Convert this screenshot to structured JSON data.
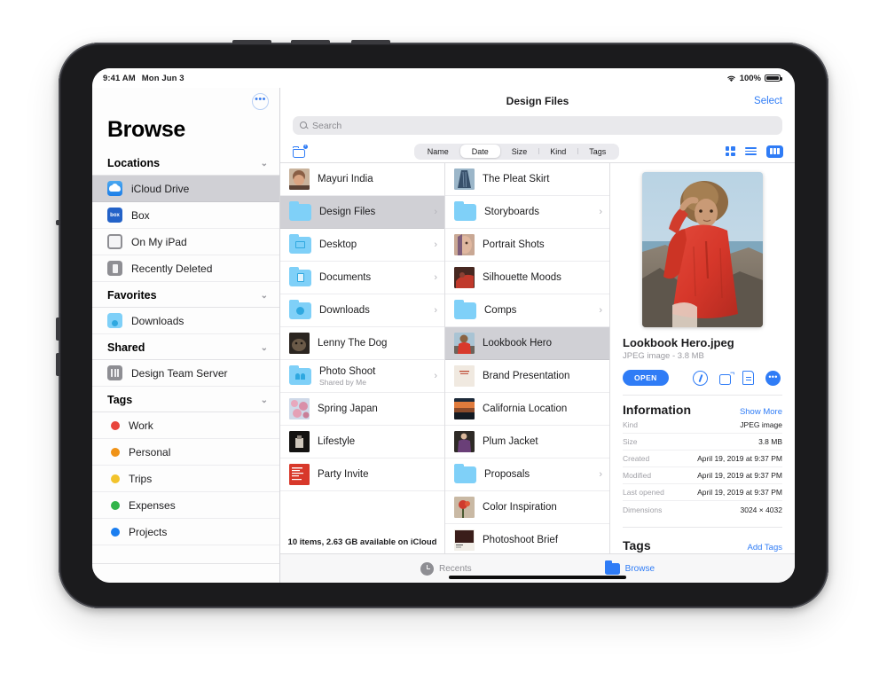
{
  "status_bar": {
    "time": "9:41 AM",
    "date": "Mon Jun 3",
    "battery_percent": "100%",
    "wifi_icon": "wifi-icon",
    "battery_icon": "battery-full-icon"
  },
  "sidebar": {
    "more_button": "•••",
    "title": "Browse",
    "sections": [
      {
        "name": "Locations",
        "chevron": "⌄",
        "items": [
          {
            "label": "iCloud Drive",
            "icon": "icloud-icon",
            "selected": true
          },
          {
            "label": "Box",
            "icon": "box-icon",
            "selected": false
          },
          {
            "label": "On My iPad",
            "icon": "ipad-icon",
            "selected": false
          },
          {
            "label": "Recently Deleted",
            "icon": "trash-icon",
            "selected": false
          }
        ]
      },
      {
        "name": "Favorites",
        "chevron": "⌄",
        "items": [
          {
            "label": "Downloads",
            "icon": "downloads-folder-icon",
            "selected": false
          }
        ]
      },
      {
        "name": "Shared",
        "chevron": "⌄",
        "items": [
          {
            "label": "Design Team Server",
            "icon": "server-icon",
            "selected": false
          }
        ]
      },
      {
        "name": "Tags",
        "chevron": "⌄",
        "items": [
          {
            "label": "Work",
            "icon": "tag-dot-icon",
            "color": "#e8453c",
            "selected": false
          },
          {
            "label": "Personal",
            "icon": "tag-dot-icon",
            "color": "#f09318",
            "selected": false
          },
          {
            "label": "Trips",
            "icon": "tag-dot-icon",
            "color": "#f2c32c",
            "selected": false
          },
          {
            "label": "Expenses",
            "icon": "tag-dot-icon",
            "color": "#32b44a",
            "selected": false
          },
          {
            "label": "Projects",
            "icon": "tag-dot-icon",
            "color": "#1b7ef0",
            "selected": false
          }
        ]
      }
    ]
  },
  "nav": {
    "title": "Design Files",
    "select_label": "Select"
  },
  "search": {
    "placeholder": "Search",
    "value": "",
    "icon": "search-icon"
  },
  "toolbar": {
    "new_folder_icon": "new-folder-icon",
    "sort_options": [
      "Name",
      "Date",
      "Size",
      "Kind",
      "Tags"
    ],
    "sort_selected": "Date",
    "view_modes": [
      {
        "icon": "grid-view-icon",
        "active": false
      },
      {
        "icon": "list-view-icon",
        "active": false
      },
      {
        "icon": "column-view-icon",
        "active": true
      }
    ]
  },
  "column_one": {
    "items": [
      {
        "label": "Mayuri India",
        "type": "image",
        "thumb": "portrait-smiling",
        "chevron": false
      },
      {
        "label": "Design Files",
        "type": "folder",
        "folder_glyph": "plain",
        "chevron": true,
        "selected": true
      },
      {
        "label": "Desktop",
        "type": "folder",
        "folder_glyph": "desktop",
        "chevron": true
      },
      {
        "label": "Documents",
        "type": "folder",
        "folder_glyph": "doc",
        "chevron": true
      },
      {
        "label": "Downloads",
        "type": "folder",
        "folder_glyph": "download",
        "chevron": true
      },
      {
        "label": "Lenny The Dog",
        "type": "image",
        "thumb": "dog-dark",
        "chevron": false
      },
      {
        "label": "Photo Shoot",
        "sublabel": "Shared by Me",
        "type": "folder",
        "folder_glyph": "people",
        "chevron": true
      },
      {
        "label": "Spring Japan",
        "type": "image",
        "thumb": "blossom-pink",
        "chevron": false
      },
      {
        "label": "Lifestyle",
        "type": "image",
        "thumb": "dark-still",
        "chevron": false
      },
      {
        "label": "Party Invite",
        "type": "image",
        "thumb": "red-poster",
        "chevron": false
      }
    ],
    "footer": "10 items, 2.63 GB available on iCloud"
  },
  "column_two": {
    "items": [
      {
        "label": "The Pleat Skirt",
        "type": "image",
        "thumb": "pleat-skirt",
        "chevron": false
      },
      {
        "label": "Storyboards",
        "type": "folder",
        "folder_glyph": "plain",
        "chevron": true
      },
      {
        "label": "Portrait Shots",
        "type": "image",
        "thumb": "portrait-blur",
        "chevron": false
      },
      {
        "label": "Silhouette Moods",
        "type": "image",
        "thumb": "silhouette-red",
        "chevron": false
      },
      {
        "label": "Comps",
        "type": "folder",
        "folder_glyph": "plain",
        "chevron": true
      },
      {
        "label": "Lookbook Hero",
        "type": "image",
        "thumb": "lookbook-hero",
        "chevron": false,
        "selected": true
      },
      {
        "label": "Brand Presentation",
        "type": "image",
        "thumb": "brand-cream",
        "chevron": false
      },
      {
        "label": "California Location",
        "type": "image",
        "thumb": "california-sunset",
        "chevron": false
      },
      {
        "label": "Plum Jacket",
        "type": "image",
        "thumb": "plum-jacket",
        "chevron": false
      },
      {
        "label": "Proposals",
        "type": "folder",
        "folder_glyph": "plain",
        "chevron": true
      },
      {
        "label": "Color Inspiration",
        "type": "image",
        "thumb": "color-flower",
        "chevron": false
      },
      {
        "label": "Photoshoot Brief",
        "type": "image",
        "thumb": "brief-dark",
        "chevron": false
      }
    ]
  },
  "detail": {
    "preview_alt": "lookbook-hero-preview",
    "file_name": "Lookbook Hero.jpeg",
    "file_meta": "JPEG image - 3.8 MB",
    "open_label": "OPEN",
    "actions": [
      {
        "icon": "markup-icon"
      },
      {
        "icon": "rotate-icon"
      },
      {
        "icon": "document-icon"
      },
      {
        "icon": "more-icon"
      }
    ],
    "information_title": "Information",
    "show_more_label": "Show More",
    "info_rows": [
      {
        "key": "Kind",
        "value": "JPEG image"
      },
      {
        "key": "Size",
        "value": "3.8 MB"
      },
      {
        "key": "Created",
        "value": "April 19, 2019 at 9:37 PM"
      },
      {
        "key": "Modified",
        "value": "April 19, 2019 at 9:37 PM"
      },
      {
        "key": "Last opened",
        "value": "April 19, 2019 at 9:37 PM"
      },
      {
        "key": "Dimensions",
        "value": "3024 × 4032"
      }
    ],
    "tags_title": "Tags",
    "add_tags_label": "Add Tags"
  },
  "tabbar": {
    "tabs": [
      {
        "label": "Recents",
        "icon": "clock-icon",
        "active": false
      },
      {
        "label": "Browse",
        "icon": "folder-icon",
        "active": true
      }
    ]
  }
}
